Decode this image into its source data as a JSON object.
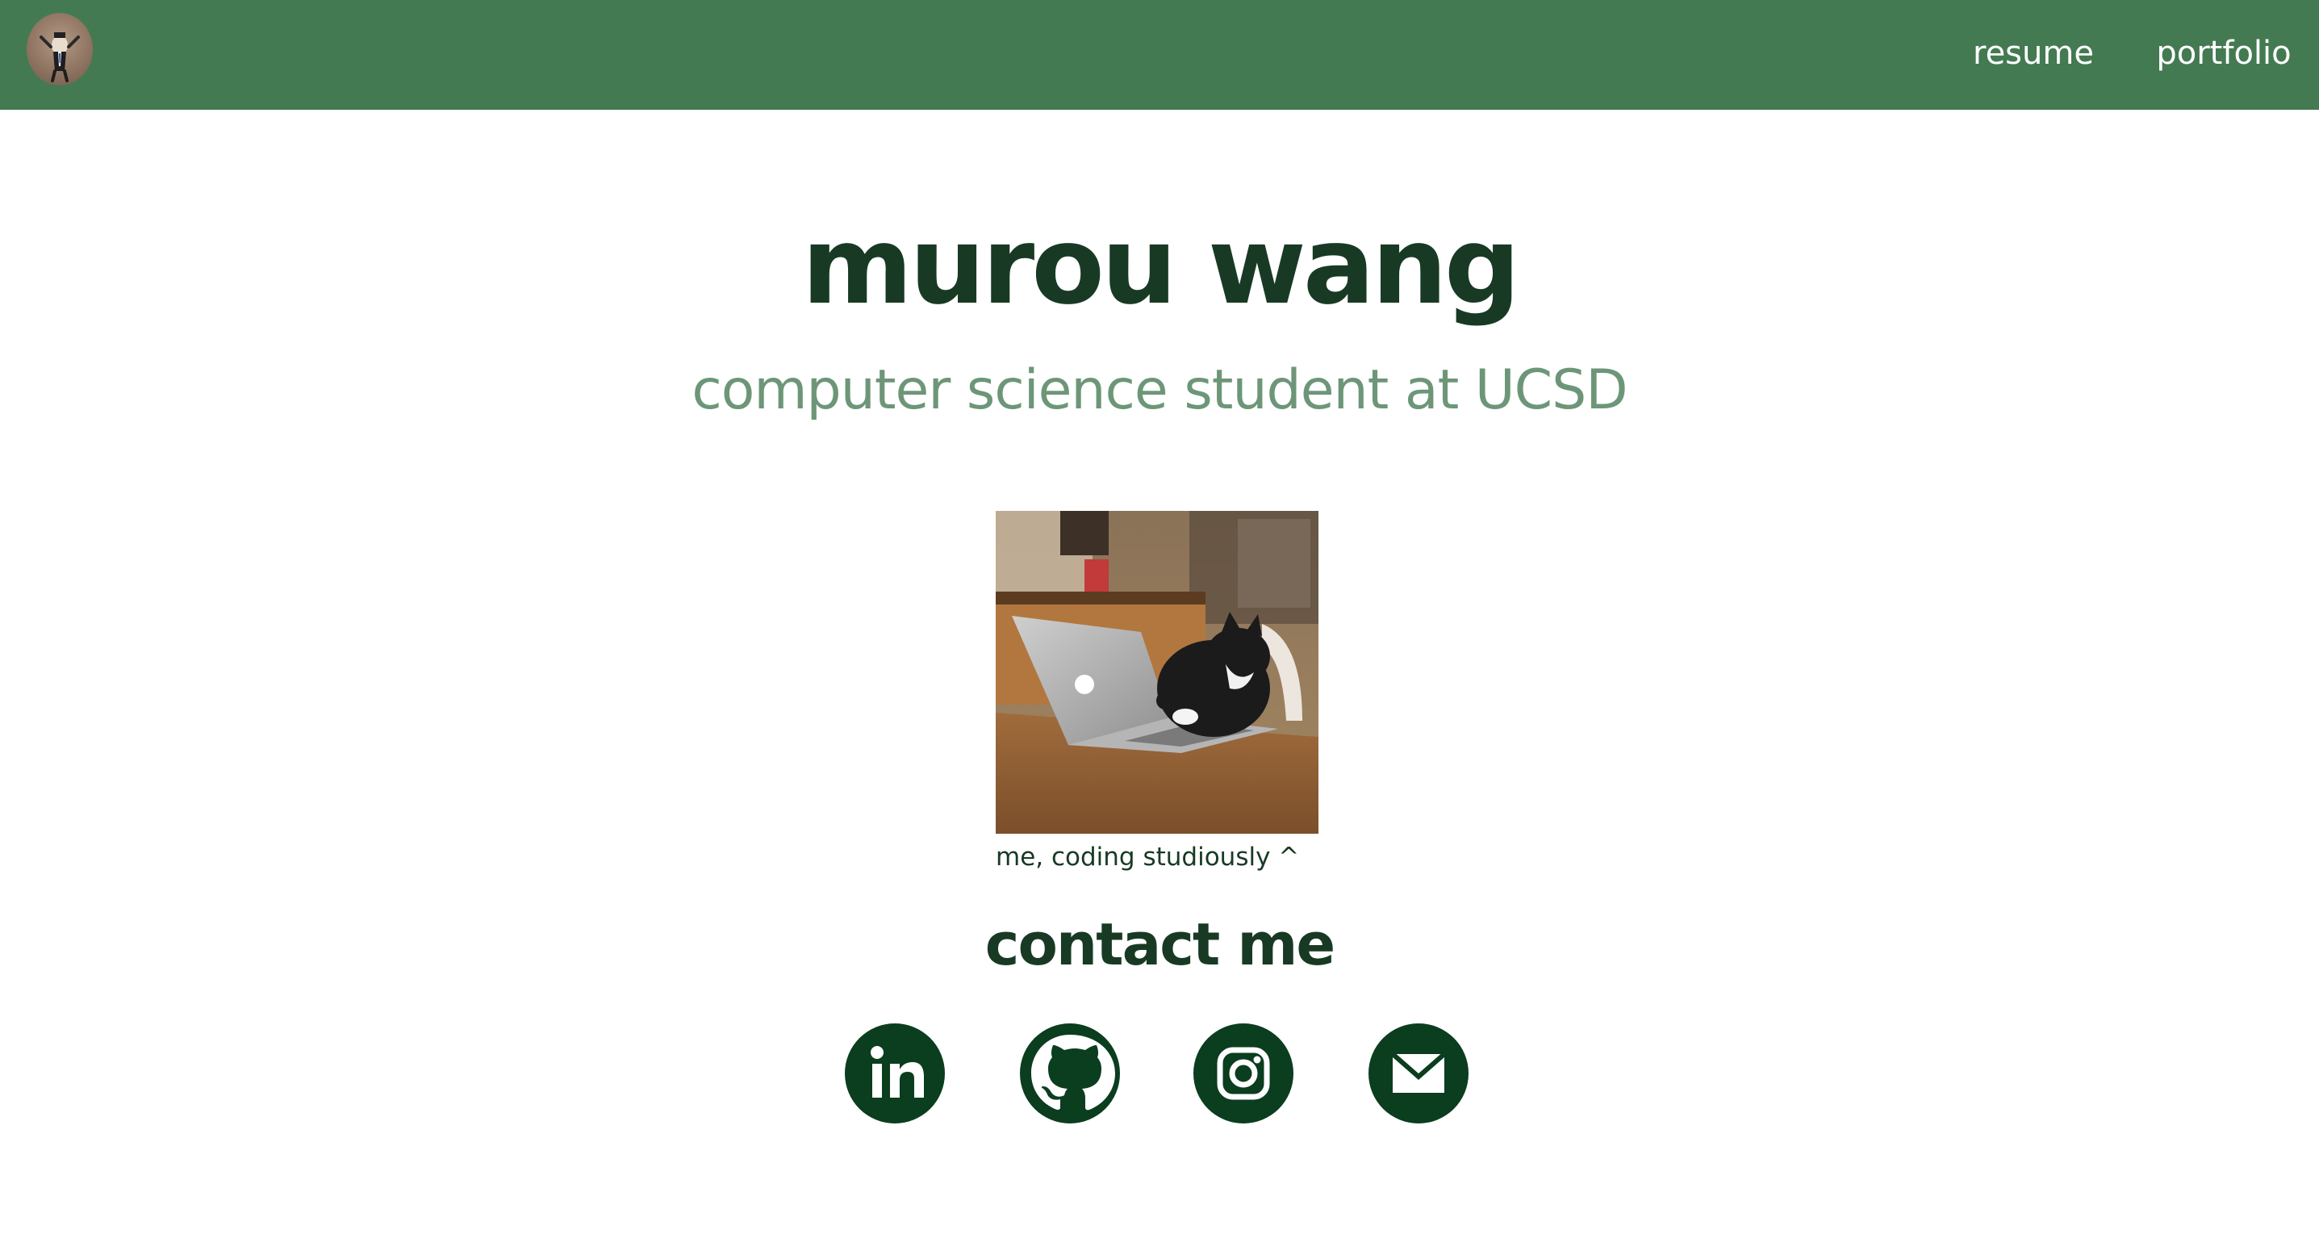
{
  "nav": {
    "avatar_icon": "profile-avatar-icon",
    "links": [
      {
        "label": "resume"
      },
      {
        "label": "portfolio"
      }
    ],
    "background_color": "#437a51"
  },
  "hero": {
    "name": "murou wang",
    "subtitle": "computer science student at UCSD"
  },
  "photo": {
    "caption": "me, coding studiously ^"
  },
  "contact": {
    "heading": "contact me",
    "links": [
      {
        "icon": "linkedin-icon"
      },
      {
        "icon": "github-icon"
      },
      {
        "icon": "instagram-icon"
      },
      {
        "icon": "email-icon"
      }
    ],
    "icon_color": "#0b3d1f"
  },
  "colors": {
    "heading": "#183a24",
    "subtitle": "#6d9679"
  }
}
